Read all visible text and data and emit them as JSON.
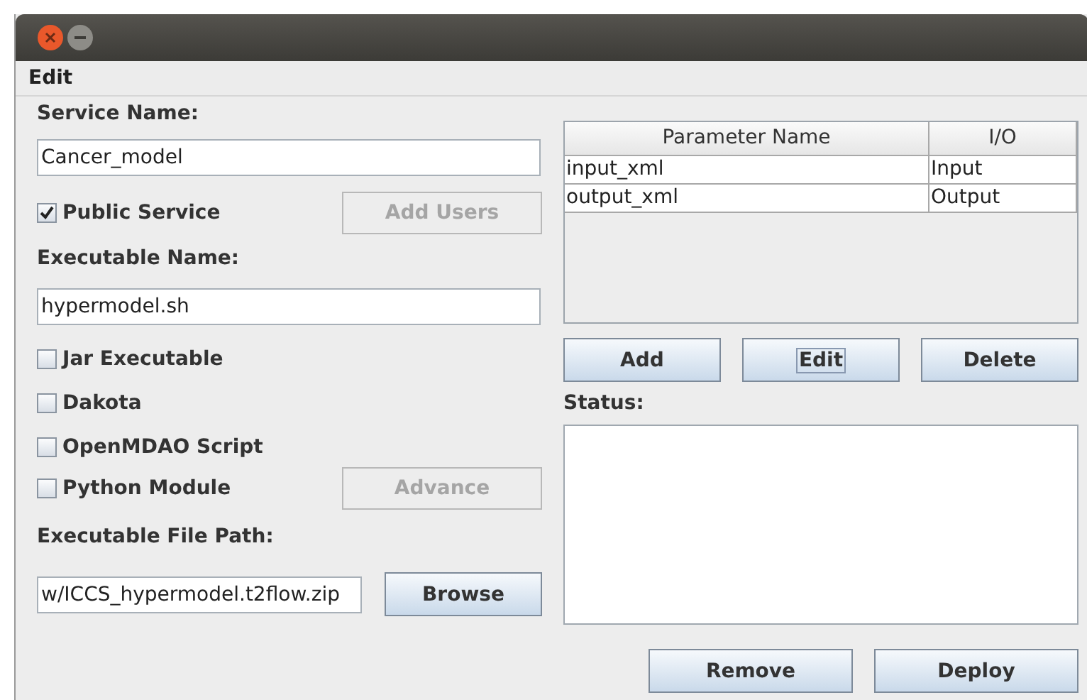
{
  "window": {
    "controls": [
      {
        "kind": "close"
      },
      {
        "kind": "minimize"
      }
    ]
  },
  "menu": [
    {
      "label": "Edit"
    }
  ],
  "service_name": {
    "label": "Service Name:",
    "value": "Cancer_model"
  },
  "public_service": {
    "label": "Public Service",
    "checked": true
  },
  "add_users": {
    "label": "Add Users",
    "disabled": true
  },
  "executable_name": {
    "label": "Executable Name:",
    "value": "hypermodel.sh"
  },
  "options": [
    {
      "label": "Jar Executable",
      "checked": false
    },
    {
      "label": "Dakota",
      "checked": false
    },
    {
      "label": "OpenMDAO Script",
      "checked": false
    },
    {
      "label": "Python Module",
      "checked": false
    }
  ],
  "advance": {
    "label": "Advance",
    "disabled": true
  },
  "executable_file_path": {
    "label": "Executable File Path:",
    "value": "w/ICCS_hypermodel.t2flow.zip"
  },
  "browse": {
    "label": "Browse",
    "disabled": false
  },
  "table": {
    "columns": [
      "Parameter Name",
      "I/O"
    ],
    "rows": [
      [
        "input_xml",
        "Input"
      ],
      [
        "output_xml",
        "Output"
      ]
    ]
  },
  "table_buttons": [
    {
      "label": "Add",
      "focused": false
    },
    {
      "label": "Edit",
      "focused": true
    },
    {
      "label": "Delete",
      "focused": false
    }
  ],
  "status": {
    "label": "Status:"
  },
  "bottom_buttons": [
    {
      "label": "Remove"
    },
    {
      "label": "Deploy"
    }
  ]
}
